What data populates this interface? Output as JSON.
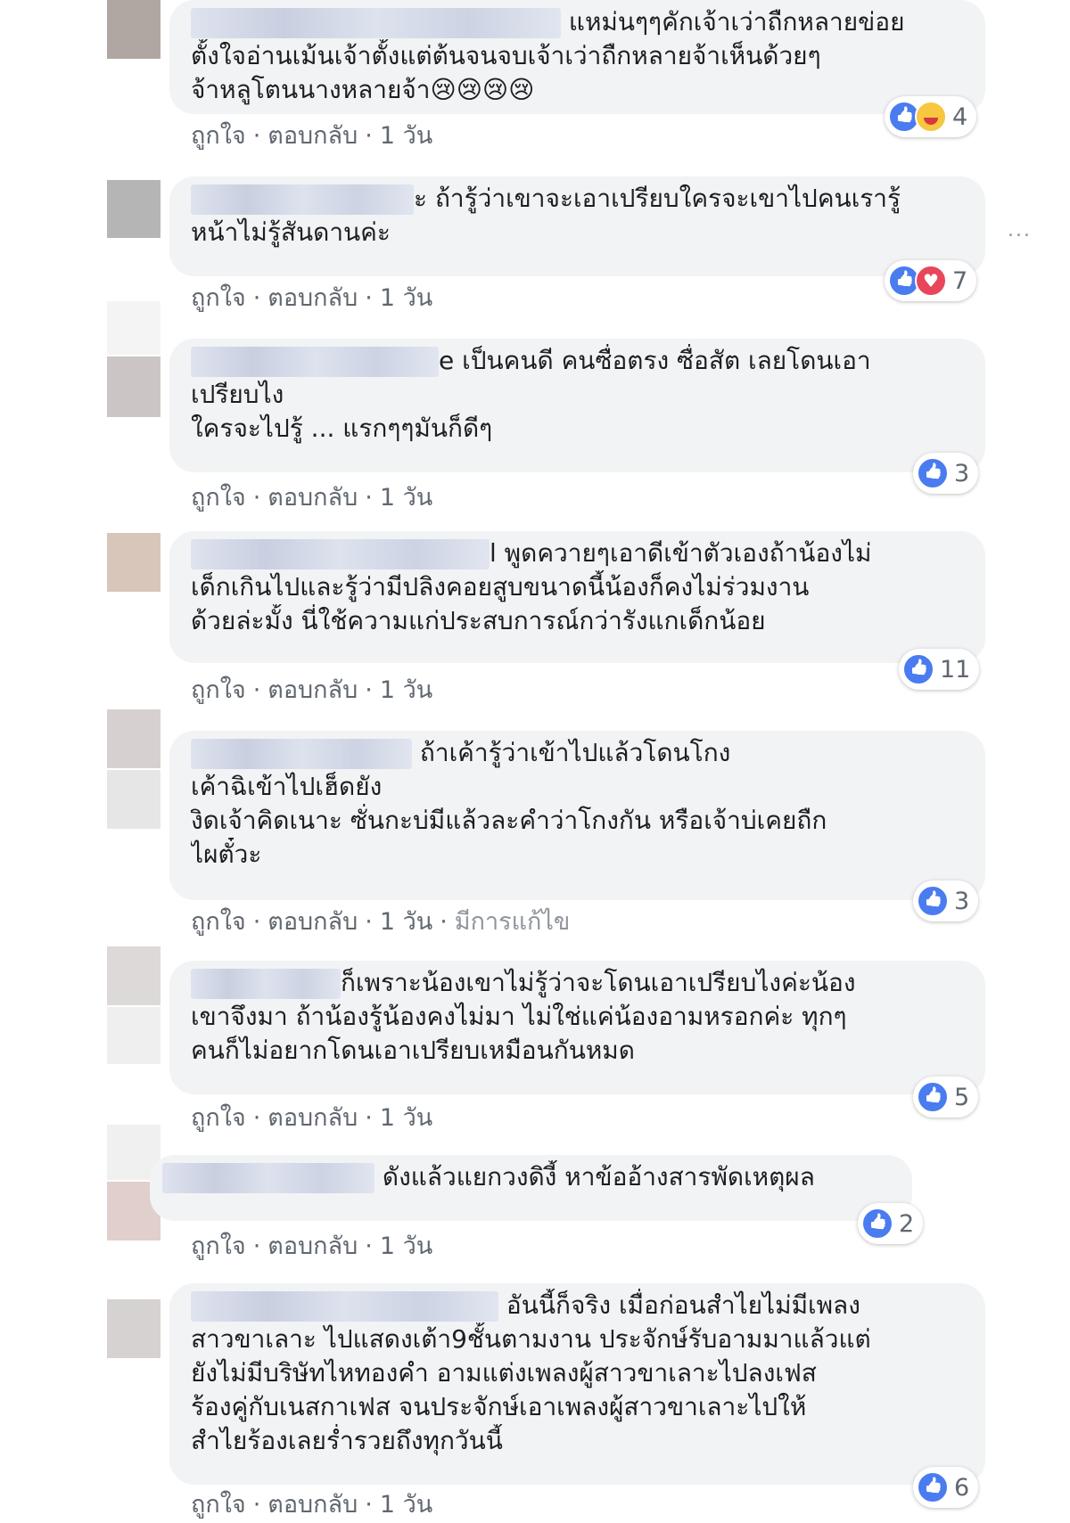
{
  "comments": [
    {
      "text": [
        "แหม่นๆๆคักเจ้าเว่าถืกหลายข่อย",
        "ตั้งใจอ่านเม้นเจ้าตั้งแต่ต้นจนจบเจ้าเว่าถืกหลายจ้าเห็นด้วยๆ",
        "จ้าหลูโตนนางหลายจ้า😢😢😢😢"
      ],
      "meta": {
        "like": "ถูกใจ",
        "reply": "ตอบกลับ",
        "time": "1 วัน"
      },
      "reactions": {
        "icons": [
          "like",
          "haha"
        ],
        "count": "4"
      }
    },
    {
      "text": [
        "ะ ถ้ารู้ว่าเขาจะเอาเปรียบใครจะเขาไปคนเรารู้",
        "หน้าไม่รู้สันดานค่ะ"
      ],
      "meta": {
        "like": "ถูกใจ",
        "reply": "ตอบกลับ",
        "time": "1 วัน"
      },
      "reactions": {
        "icons": [
          "like",
          "love"
        ],
        "count": "7"
      }
    },
    {
      "text": [
        "e เป็นคนดี คนซื่อตรง ซื่อสัต เลยโดนเอา",
        "เปรียบไง",
        "ใครจะไปรู้ ... แรกๆๆมันก็ดีๆ"
      ],
      "meta": {
        "like": "ถูกใจ",
        "reply": "ตอบกลับ",
        "time": "1 วัน"
      },
      "reactions": {
        "icons": [
          "like"
        ],
        "count": "3"
      }
    },
    {
      "text": [
        "l พูดควายๆเอาดีเข้าตัวเองถ้าน้องไม่",
        "เด็กเกินไปและรู้ว่ามีปลิงคอยสูบขนาดนี้น้องก็คงไม่ร่วมงาน",
        "ด้วยล่ะมั้ง นี่ใช้ความแก่ประสบการณ์กว่ารังแกเด็กน้อย"
      ],
      "meta": {
        "like": "ถูกใจ",
        "reply": "ตอบกลับ",
        "time": "1 วัน"
      },
      "reactions": {
        "icons": [
          "like"
        ],
        "count": "11"
      }
    },
    {
      "text": [
        "ถ้าเค้ารู้ว่าเข้าไปแล้วโดนโกง",
        "เค้าฉิเข้าไปเฮ็ดยัง",
        "งิดเจ้าคิดเนาะ ซั่นกะบ่มีแล้วละคำว่าโกงกัน หรือเจ้าบ่เคยถืก",
        "ไผตั๋วะ"
      ],
      "meta": {
        "like": "ถูกใจ",
        "reply": "ตอบกลับ",
        "time": "1 วัน",
        "edited": "มีการแก้ไข"
      },
      "reactions": {
        "icons": [
          "like"
        ],
        "count": "3"
      }
    },
    {
      "text": [
        "ก็เพราะน้องเขาไม่รู้ว่าจะโดนเอาเปรียบไงค่ะน้อง",
        "เขาจึงมา ถ้าน้องรู้น้องคงไม่มา ไม่ใช่แค่น้องอามหรอกค่ะ ทุกๆ",
        "คนก็ไม่อยากโดนเอาเปรียบเหมือนกันหมด"
      ],
      "meta": {
        "like": "ถูกใจ",
        "reply": "ตอบกลับ",
        "time": "1 วัน"
      },
      "reactions": {
        "icons": [
          "like"
        ],
        "count": "5"
      }
    },
    {
      "text": [
        "ดังแล้วแยกวงดิงี้ หาข้ออ้างสารพัดเหตุผล"
      ],
      "meta": {
        "like": "ถูกใจ",
        "reply": "ตอบกลับ",
        "time": "1 วัน"
      },
      "reactions": {
        "icons": [
          "like"
        ],
        "count": "2"
      }
    },
    {
      "text": [
        "อันนี้ก็จริง เมื่อก่อนสำไยไม่มีเพลง",
        "สาวขาเลาะ ไปแสดงเต้า9ชั้นตามงาน ประจักษ์รับอามมาแล้วแต่",
        "ยังไม่มีบริษัทไหทองคำ อามแต่งเพลงผู้สาวขาเลาะไปลงเฟส",
        "ร้องคู่กับเนสกาเฟส จนประจักษ์เอาเพลงผู้สาวขาเลาะไปให้",
        "สำไยร้องเลยร่ำรวยถึงทุกวันนี้"
      ],
      "meta": {
        "like": "ถูกใจ",
        "reply": "ตอบกลับ",
        "time": "1 วัน"
      },
      "reactions": {
        "icons": [
          "like"
        ],
        "count": "6"
      }
    }
  ],
  "more_options": "...",
  "colors": {
    "bubble": "#f2f3f5",
    "like": "#4a7cf0",
    "meta": "#606770"
  }
}
